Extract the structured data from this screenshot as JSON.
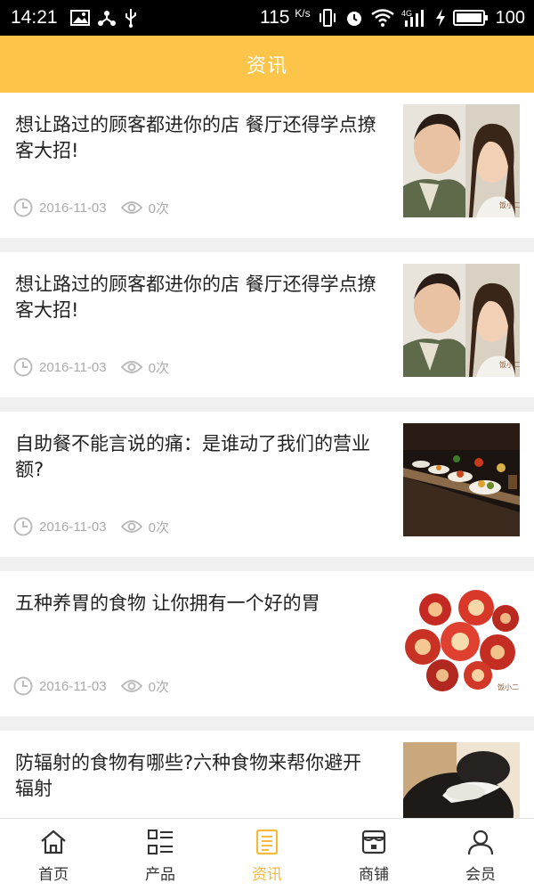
{
  "status_bar": {
    "time": "14:21",
    "speed": "115",
    "speed_unit": "K/s",
    "battery": "100"
  },
  "header": {
    "title": "资讯"
  },
  "articles": [
    {
      "title": "想让路过的顾客都进你的店 餐厅还得学点撩客大招!",
      "date": "2016-11-03",
      "views": "0次",
      "image": "couple-photo"
    },
    {
      "title": "想让路过的顾客都进你的店 餐厅还得学点撩客大招!",
      "date": "2016-11-03",
      "views": "0次",
      "image": "couple-photo"
    },
    {
      "title": "自助餐不能言说的痛：是谁动了我们的营业额?",
      "date": "2016-11-03",
      "views": "0次",
      "image": "buffet-photo"
    },
    {
      "title": "五种养胃的食物 让你拥有一个好的胃",
      "date": "2016-11-03",
      "views": "0次",
      "image": "hawthorn-photo"
    },
    {
      "title": "防辐射的食物有哪些?六种食物来帮你避开辐射",
      "date": "",
      "views": "",
      "image": "sesame-photo"
    }
  ],
  "tabs": [
    {
      "label": "首页",
      "icon": "home-icon"
    },
    {
      "label": "产品",
      "icon": "grid-list-icon"
    },
    {
      "label": "资讯",
      "icon": "news-icon",
      "active": true
    },
    {
      "label": "商铺",
      "icon": "store-icon"
    },
    {
      "label": "会员",
      "icon": "user-icon"
    }
  ],
  "colors": {
    "accent": "#fcc54a",
    "active_tab": "#f6b93b"
  }
}
